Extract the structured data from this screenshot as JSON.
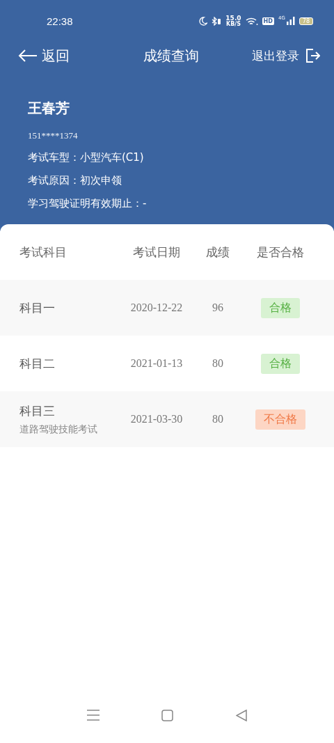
{
  "status_bar": {
    "time": "22:38",
    "speed_value": "15.0",
    "speed_unit": "KB/S",
    "hd": "HD",
    "network": "4G",
    "battery": "78"
  },
  "nav": {
    "back": "返回",
    "title": "成绩查询",
    "logout": "退出登录"
  },
  "profile": {
    "name": "王春芳",
    "phone": "151****1374",
    "lines": [
      "考试车型：小型汽车(C1)",
      "考试原因：初次申领",
      "学习驾驶证明有效期止：-"
    ]
  },
  "table": {
    "columns": [
      "考试科目",
      "考试日期",
      "成绩",
      "是否合格"
    ],
    "rows": [
      {
        "subject": "科目一",
        "date": "2020-12-22",
        "score": "96",
        "result": "合格",
        "passed": true
      },
      {
        "subject": "科目二",
        "date": "2021-01-13",
        "score": "80",
        "result": "合格",
        "passed": true
      },
      {
        "subject": "科目三",
        "subtitle": "道路驾驶技能考试",
        "date": "2021-03-30",
        "score": "80",
        "result": "不合格",
        "passed": false
      }
    ]
  }
}
